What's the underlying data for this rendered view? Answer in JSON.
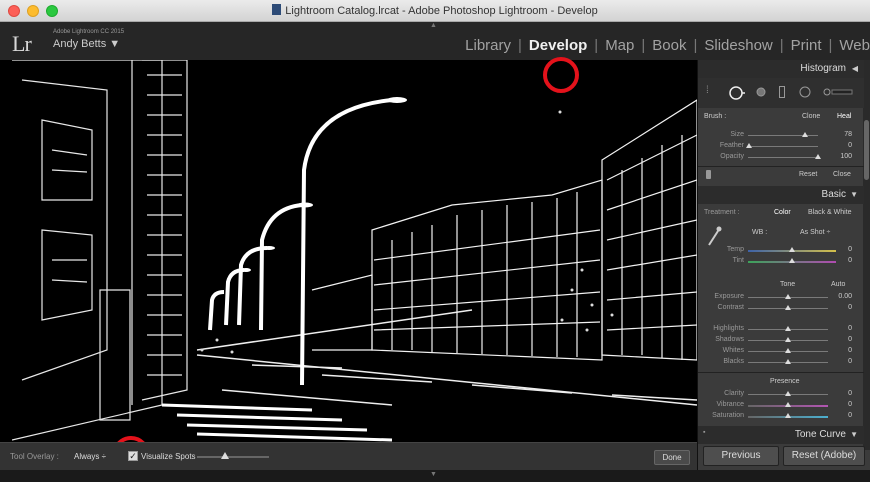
{
  "window": {
    "title": "Lightroom Catalog.lrcat - Adobe Photoshop Lightroom - Develop"
  },
  "identity": {
    "logo": "Lr",
    "product": "Adobe Lightroom CC 2015",
    "user": "Andy Betts ▼"
  },
  "modules": [
    {
      "label": "Library",
      "active": false
    },
    {
      "label": "Develop",
      "active": true
    },
    {
      "label": "Map",
      "active": false
    },
    {
      "label": "Book",
      "active": false
    },
    {
      "label": "Slideshow",
      "active": false
    },
    {
      "label": "Print",
      "active": false
    },
    {
      "label": "Web",
      "active": false
    }
  ],
  "module_separator": "|",
  "toolbar": {
    "overlay_label": "Tool Overlay :",
    "overlay_value": "Always ÷",
    "visualize_spots_label": "Visualize Spots",
    "visualize_spots_checked": true,
    "visualize_threshold": 0.35,
    "done_label": "Done"
  },
  "panel": {
    "histogram_title": "Histogram",
    "brush": {
      "label": "Brush :",
      "clone_label": "Clone",
      "heal_label": "Heal",
      "size_label": "Size",
      "size_value": "78",
      "feather_label": "Feather",
      "feather_value": "0",
      "opacity_label": "Opacity",
      "opacity_value": "100",
      "reset_label": "Reset",
      "close_label": "Close"
    },
    "basic": {
      "title": "Basic",
      "treatment_label": "Treatment :",
      "color_label": "Color",
      "bw_label": "Black & White",
      "wb_label": "WB :",
      "wb_value": "As Shot ÷",
      "temp_label": "Temp",
      "temp_value": "0",
      "tint_label": "Tint",
      "tint_value": "0",
      "tone_label": "Tone",
      "auto_label": "Auto",
      "exposure_label": "Exposure",
      "exposure_value": "0.00",
      "contrast_label": "Contrast",
      "contrast_value": "0",
      "highlights_label": "Highlights",
      "highlights_value": "0",
      "shadows_label": "Shadows",
      "shadows_value": "0",
      "whites_label": "Whites",
      "whites_value": "0",
      "blacks_label": "Blacks",
      "blacks_value": "0",
      "presence_label": "Presence",
      "clarity_label": "Clarity",
      "clarity_value": "0",
      "vibrance_label": "Vibrance",
      "vibrance_value": "0",
      "saturation_label": "Saturation",
      "saturation_value": "0"
    },
    "tone_curve_title": "Tone Curve"
  },
  "footer": {
    "previous_label": "Previous",
    "reset_label": "Reset (Adobe)"
  },
  "colors": {
    "annotation_red": "#e4121b",
    "panel_bg": "#3b3b3b"
  },
  "icons": [
    "doc-icon",
    "triangle-left-icon",
    "triangle-down-icon",
    "spot-removal-icon",
    "brush-pin-icon"
  ]
}
